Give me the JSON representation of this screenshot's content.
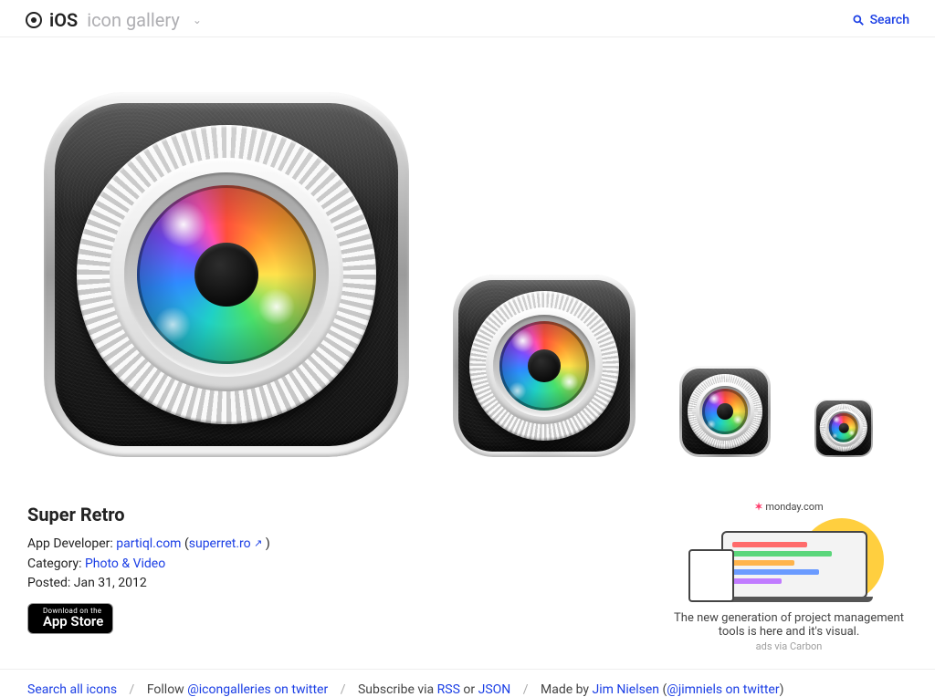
{
  "header": {
    "brand_primary": "iOS",
    "brand_secondary": "icon gallery",
    "search_label": "Search"
  },
  "app": {
    "title": "Super Retro",
    "developer_label": "App Developer:",
    "developer_link": "partiql.com",
    "developer_site_open": "(",
    "developer_site": "superret.ro",
    "developer_site_ext": "↗",
    "developer_site_close": ")",
    "category_label": "Category:",
    "category_link": "Photo & Video",
    "posted_label": "Posted:",
    "posted_value": "Jan 31, 2012",
    "appstore_t1": "Download on the",
    "appstore_t2": "App Store"
  },
  "ad": {
    "brand": "monday.com",
    "headline": "The new generation of project management tools is here and it's visual.",
    "provider": "ads via Carbon"
  },
  "footer": {
    "search_all": "Search all icons",
    "follow_pre": "Follow",
    "follow_link": "@icongalleries on twitter",
    "subscribe_pre": "Subscribe via",
    "subscribe_rss": "RSS",
    "subscribe_or": "or",
    "subscribe_json": "JSON",
    "made_pre": "Made by",
    "made_name": "Jim Nielsen",
    "made_link": "@jimniels on twitter",
    "paren_open": "(",
    "paren_close": ")"
  }
}
